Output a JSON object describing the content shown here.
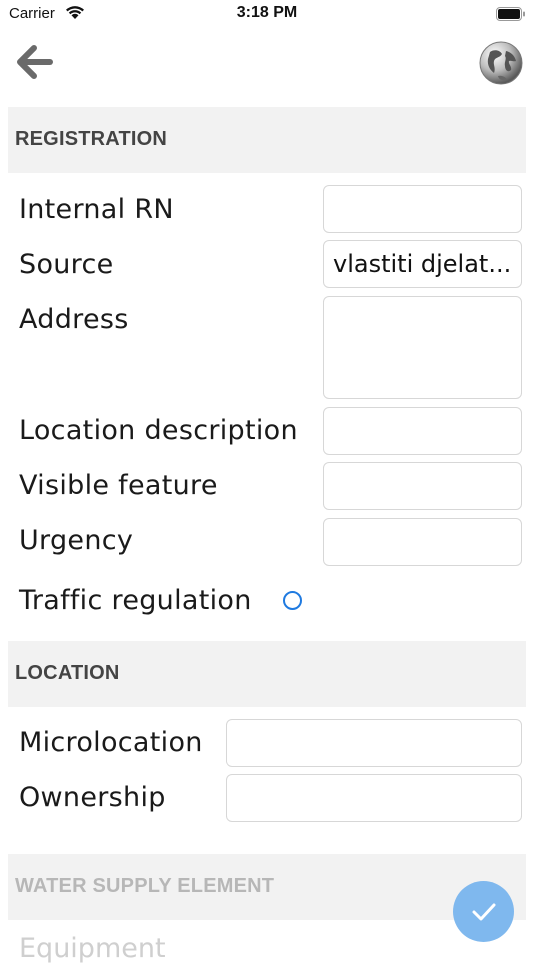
{
  "status_bar": {
    "carrier": "Carrier",
    "time": "3:18 PM"
  },
  "nav": {
    "back_icon": "arrow-left-icon",
    "globe_icon": "globe-icon"
  },
  "registration": {
    "header": "REGISTRATION",
    "internal_rn": {
      "label": "Internal RN",
      "value": ""
    },
    "source": {
      "label": "Source",
      "value": "vlastiti djelat..."
    },
    "address": {
      "label": "Address",
      "value": ""
    },
    "location_description": {
      "label": "Location description",
      "value": ""
    },
    "visible_feature": {
      "label": "Visible feature",
      "value": ""
    },
    "urgency": {
      "label": "Urgency",
      "value": ""
    },
    "traffic_regulation": {
      "label": "Traffic regulation",
      "checked": false
    }
  },
  "location": {
    "header": "LOCATION",
    "microlocation": {
      "label": "Microlocation",
      "value": ""
    },
    "ownership": {
      "label": "Ownership",
      "value": ""
    }
  },
  "water_supply": {
    "header": "WATER SUPPLY ELEMENT",
    "next_label": "Equipment"
  },
  "fab": {
    "icon": "checkmark-icon"
  },
  "colors": {
    "accent": "#1f7ae0",
    "fab": "#7fb8ee",
    "header_bg": "#f2f2f2"
  }
}
